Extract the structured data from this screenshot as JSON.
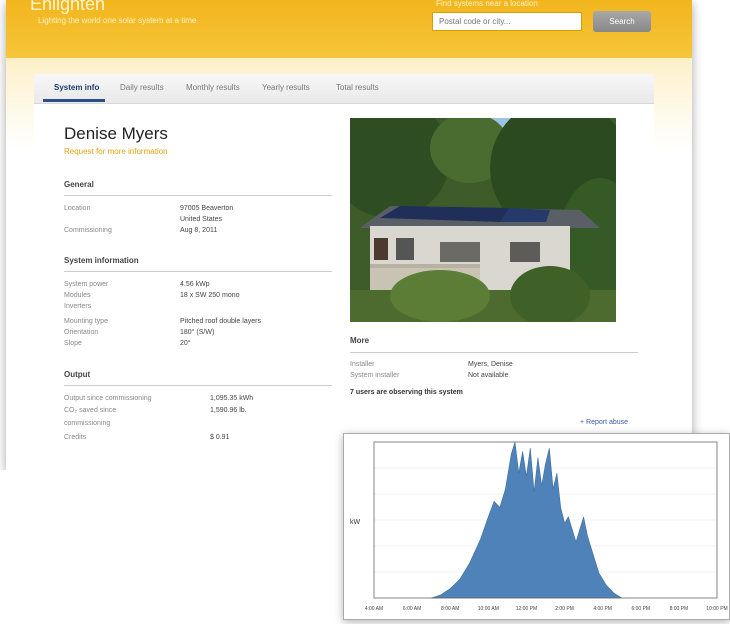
{
  "header": {
    "brand": "Enlighten",
    "tagline": "Lighting the world one solar system at a time",
    "search_label": "Find systems near a location",
    "search_placeholder": "Postal code or city...",
    "search_button": "Search"
  },
  "tabs": [
    "System info",
    "Daily results",
    "Monthly results",
    "Yearly results",
    "Total results"
  ],
  "profile": {
    "name": "Denise Myers",
    "subtitle": "Request for more information"
  },
  "general": {
    "title": "General",
    "rows": [
      {
        "label": "Location",
        "value": "97005 Beaverton"
      },
      {
        "label": "",
        "value": "United States"
      },
      {
        "label": "Commissioning",
        "value": "Aug 8, 2011"
      }
    ]
  },
  "system": {
    "title": "System information",
    "rows": [
      {
        "label": "System power",
        "value": "4.56 kWp"
      },
      {
        "label": "Modules",
        "value": "18 x SW 250 mono"
      },
      {
        "label": "Inverters",
        "value": ""
      },
      {
        "label": "Mounting type",
        "value": "Pitched roof double layers"
      },
      {
        "label": "Orientation",
        "value": "180° (S/W)"
      },
      {
        "label": "Slope",
        "value": "20°"
      }
    ]
  },
  "output": {
    "title": "Output",
    "rows": [
      {
        "label": "Output since commissioning",
        "value": "1,095.35 kWh"
      },
      {
        "label": "CO₂ saved since",
        "value": "1,590.96 lb."
      },
      {
        "label": "commissioning",
        "value": ""
      },
      {
        "label": "Credits",
        "value": "$ 0.91"
      }
    ]
  },
  "more": {
    "title": "More",
    "rows": [
      {
        "label": "Installer",
        "value": "Myers, Denise"
      },
      {
        "label": "System installer",
        "value": "Not available"
      }
    ],
    "observers": "7 users are observing this system",
    "report": "+ Report abuse"
  },
  "colors": {
    "header": "#f4bc2a",
    "chart_fill": "#4f82b8",
    "link": "#3a5b9c"
  },
  "chart_data": {
    "type": "area",
    "title": "",
    "xlabel": "",
    "ylabel": "kW",
    "x_ticks": [
      "4:00 AM",
      "6:00 AM",
      "8:00 AM",
      "10:00 AM",
      "12:00 PM",
      "2:00 PM",
      "4:00 PM",
      "6:00 PM",
      "8:00 PM",
      "10:00 PM"
    ],
    "y_ticks": [
      "",
      "",
      "",
      "",
      "",
      ""
    ],
    "ylim": [
      0,
      100
    ],
    "x_hours": [
      7.0,
      7.5,
      8.0,
      8.5,
      9.0,
      9.3,
      9.6,
      10.0,
      10.3,
      10.6,
      10.9,
      11.2,
      11.4,
      11.6,
      11.8,
      12.0,
      12.2,
      12.4,
      12.6,
      12.8,
      13.0,
      13.2,
      13.4,
      13.6,
      13.8,
      14.0,
      14.2,
      14.4,
      14.6,
      14.8,
      15.0,
      15.2,
      15.5,
      15.8,
      16.2,
      16.6,
      17.0
    ],
    "values": [
      0,
      2,
      6,
      12,
      22,
      30,
      38,
      52,
      62,
      58,
      70,
      92,
      100,
      80,
      94,
      78,
      96,
      68,
      90,
      72,
      86,
      96,
      70,
      80,
      58,
      48,
      52,
      44,
      36,
      44,
      52,
      40,
      28,
      16,
      8,
      3,
      0
    ]
  }
}
